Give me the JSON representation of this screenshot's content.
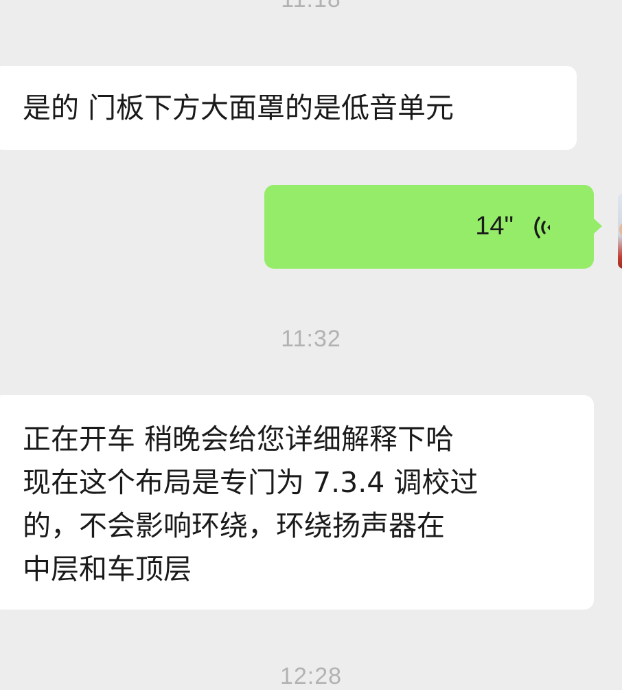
{
  "chat": {
    "timestamps": {
      "top_clipped": "11:18",
      "middle": "11:32",
      "bottom_clipped": "12:28"
    },
    "messages": [
      {
        "direction": "incoming",
        "type": "text",
        "text": "是的 门板下方大面罩的是低音单元"
      },
      {
        "direction": "outgoing",
        "type": "voice",
        "duration": "14\"",
        "icon": "voice-wave-icon"
      },
      {
        "direction": "incoming",
        "type": "text",
        "lines": [
          "正在开车 稍晚会给您详细解释下哈",
          "现在这个布局是专门为 7.3.4 调校过",
          "的，不会影响环绕，环绕扬声器在",
          "中层和车顶层"
        ]
      }
    ],
    "colors": {
      "background": "#ededed",
      "incoming_bubble": "#ffffff",
      "outgoing_bubble": "#95ec69",
      "timestamp": "#b2b2b2"
    }
  }
}
